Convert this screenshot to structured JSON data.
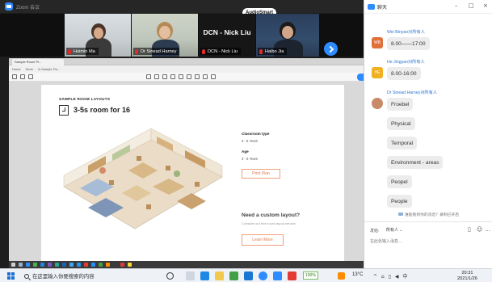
{
  "zoom": {
    "window_title": "Zoom 会议",
    "audio_pill": "AudioSmart",
    "participants": [
      {
        "name": "Huimin Ma"
      },
      {
        "name": "Dr Sinead Harney"
      },
      {
        "name": "DCN - Nick Liu",
        "display_text": "DCN - Nick Liu"
      },
      {
        "name": "Haibo Jia"
      }
    ]
  },
  "shared_doc": {
    "tab_label": "Sample Room Pl...",
    "addr_items": [
      "Home",
      "Work",
      "A-Sample Flo..."
    ],
    "section_heading": "SAMPLE ROOM LAYOUTS",
    "title": "3-5s room for 16",
    "classroom_type_label": "Classroom type",
    "classroom_type_value": "3 - 5 Years",
    "age_label": "Age",
    "age_value": "3 - 5 Years",
    "print_plan": "Print Plan",
    "need_layout": "Need a custom layout?",
    "need_desc": "Consider our free room layout service.",
    "learn_more": "Learn More"
  },
  "chat": {
    "title": "聊天",
    "minimize": "–",
    "maximize": "□",
    "close": "×",
    "messages": [
      {
        "sender": "Wei Binyan对所有人",
        "avatar_text": "WB",
        "avatar_color": "#e0703a",
        "bubbles": [
          "8.00——17:00"
        ]
      },
      {
        "sender": "He Jingyan对所有人",
        "avatar_text": "HE",
        "avatar_color": "#f0b020",
        "bubbles": [
          "8.00-16:00"
        ]
      },
      {
        "sender": "Dr Sinead Harney对所有人",
        "avatar_text": "",
        "avatar_color": "#c98a6a",
        "bubbles": [
          "Froebel",
          "Physical",
          "Temporal",
          "Environment - areas",
          "Peopel",
          "People"
        ]
      }
    ],
    "history_note": "谁能看到你的消息？录制已开启",
    "send_to_label": "发给:",
    "recipient": "所有人",
    "input_placeholder": "在此处输入消息..."
  },
  "taskbar": {
    "search_placeholder": "在这里输入你要搜索的内容",
    "notif_badge": "100%",
    "weather": "13°C",
    "tray_text": "^ ⌂ ▯ ◀ 中",
    "time": "20:31",
    "date": "2021/1/26"
  },
  "colors": {
    "zoom_blue": "#2d8cff",
    "link_blue": "#2d76d4",
    "accent_orange": "#e07c52",
    "mic_muted_red": "#e02a2a"
  }
}
